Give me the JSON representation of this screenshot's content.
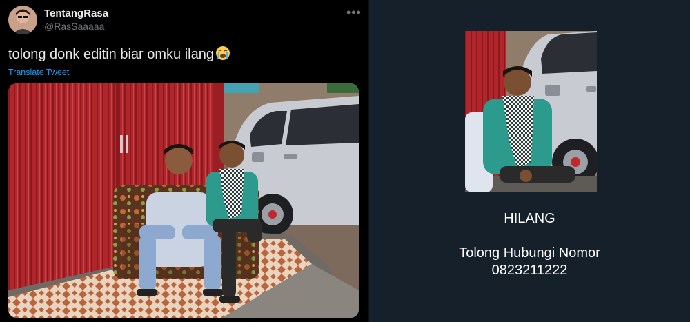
{
  "tweet": {
    "display_name": "TentangRasa",
    "handle": "@RasSaaaaa",
    "text": "tolong donk editin biar omku ilang",
    "emoji": "crying-face-emoji",
    "translate_label": "Translate Tweet",
    "more_icon": "more-horizontal-icon"
  },
  "poster": {
    "title": "HILANG",
    "line1": "Tolong Hubungi Nomor",
    "line2": "0823211222"
  },
  "colors": {
    "background_left": "#000000",
    "background_right": "#15202b",
    "link_blue": "#1d9bf0",
    "shutter_red": "#b0262b"
  }
}
